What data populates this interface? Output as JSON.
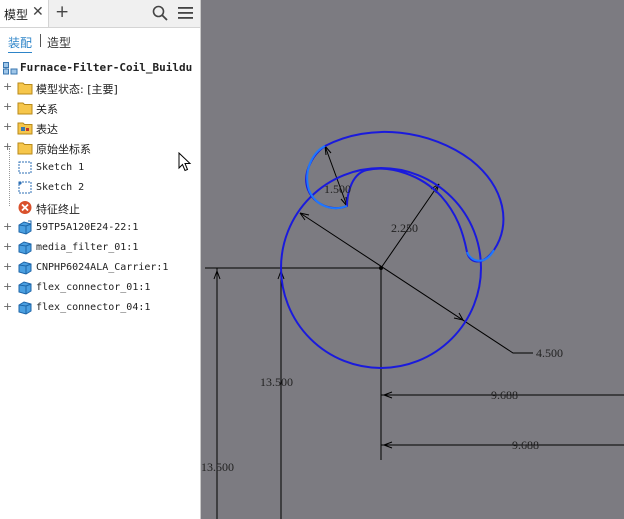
{
  "tabs": {
    "active_label": "模型",
    "close_glyph": "✕",
    "add_glyph": "+"
  },
  "subtabs": {
    "assembly": "装配",
    "modeling": "造型"
  },
  "tree": {
    "root": "Furnace-Filter-Coil_Buildu",
    "items": [
      {
        "label": "模型状态: [主要]",
        "icon": "folder-icon"
      },
      {
        "label": "关系",
        "icon": "folder-icon"
      },
      {
        "label": "表达",
        "icon": "representation-folder-icon"
      },
      {
        "label": "原始坐标系",
        "icon": "folder-icon"
      },
      {
        "label": "Sketch 1",
        "icon": "sketch-icon"
      },
      {
        "label": "Sketch 2",
        "icon": "sketch-icon"
      },
      {
        "label": "特征终止",
        "icon": "end-of-features-icon"
      },
      {
        "label": "59TP5A120E24-22:1",
        "icon": "part-icon"
      },
      {
        "label": "media_filter_01:1",
        "icon": "part-icon"
      },
      {
        "label": "CNPHP6024ALA_Carrier:1",
        "icon": "part-icon"
      },
      {
        "label": "flex_connector_01:1",
        "icon": "part-icon"
      },
      {
        "label": "flex_connector_04:1",
        "icon": "part-icon"
      }
    ]
  },
  "canvas": {
    "dimensions": [
      "1.500",
      "2.250",
      "4.500",
      "13.500",
      "9.688",
      "9.688",
      "13.500"
    ],
    "colors": {
      "background": "#7c7b81",
      "sketch": "#1a1adc",
      "highlight": "#1e78ff",
      "dimension": "#000000"
    }
  }
}
